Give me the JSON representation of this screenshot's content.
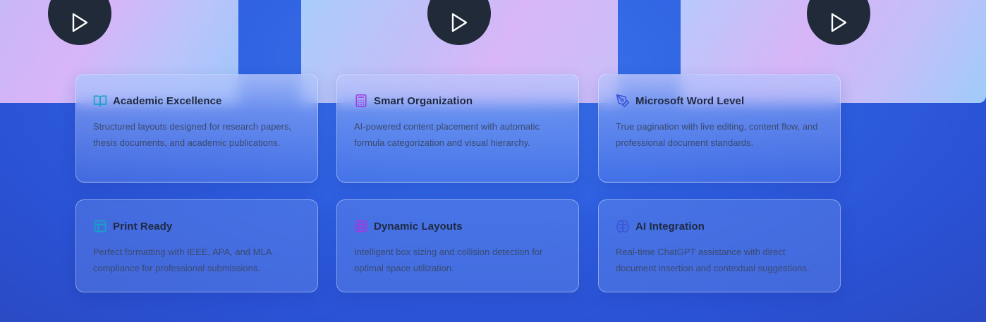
{
  "videos": [
    {
      "play_label": "Play video"
    },
    {
      "play_label": "Play video"
    },
    {
      "play_label": "Play video"
    }
  ],
  "features": [
    {
      "icon": "book-open-icon",
      "icon_color": "#14a3c7",
      "title": "Academic Excellence",
      "description": "Structured layouts designed for research papers, thesis documents, and academic publications."
    },
    {
      "icon": "calculator-icon",
      "icon_color": "#9b3de0",
      "title": "Smart Organization",
      "description": "AI-powered content placement with automatic formula categorization and visual hierarchy."
    },
    {
      "icon": "pen-tool-icon",
      "icon_color": "#3a55d8",
      "title": "Microsoft Word Level",
      "description": "True pagination with live editing, content flow, and professional document standards."
    },
    {
      "icon": "layout-icon",
      "icon_color": "#14a3c7",
      "title": "Print Ready",
      "description": "Perfect formatting with IEEE, APA, and MLA compliance for professional submissions."
    },
    {
      "icon": "grid-icon",
      "icon_color": "#9b3de0",
      "title": "Dynamic Layouts",
      "description": "Intelligent box sizing and collision detection for optimal space utilization."
    },
    {
      "icon": "brain-icon",
      "icon_color": "#3a55d8",
      "title": "AI Integration",
      "description": "Real-time ChatGPT assistance with direct document insertion and contextual suggestions."
    }
  ]
}
